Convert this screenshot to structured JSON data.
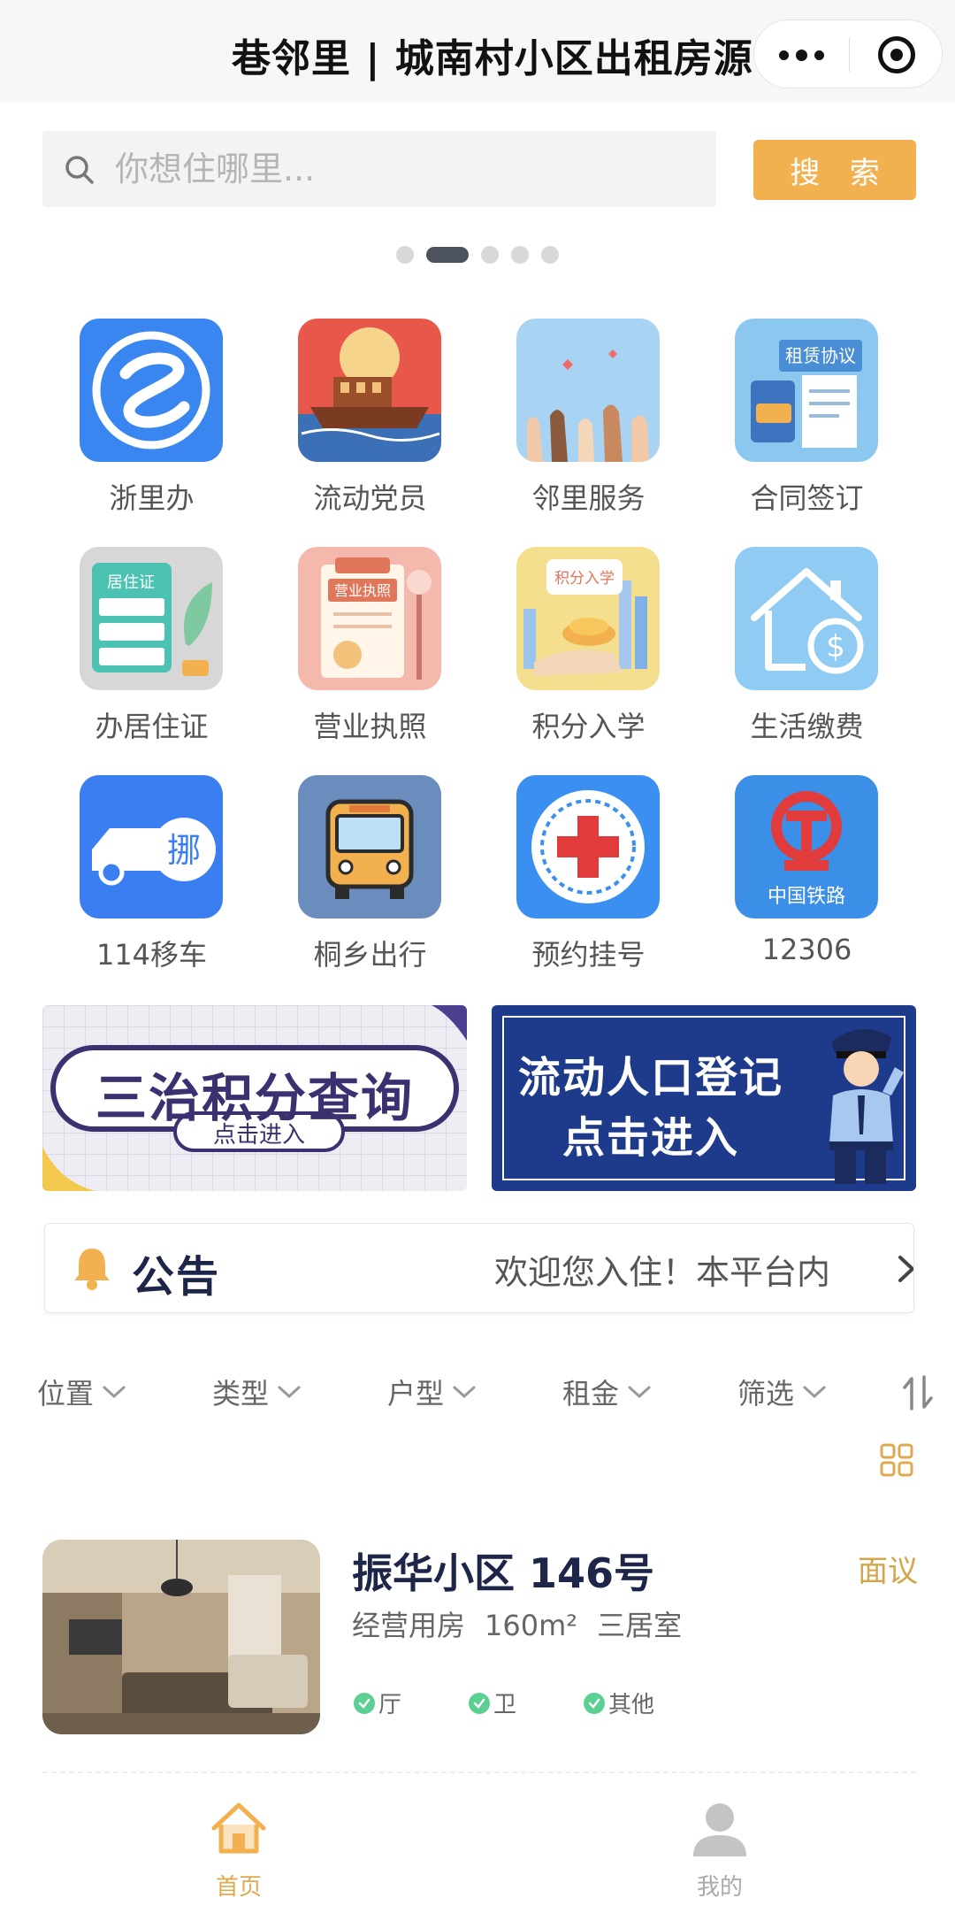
{
  "titlebar": {
    "title": "巷邻里 | 城南村小区出租房源"
  },
  "search": {
    "placeholder": "你想住哪里...",
    "button_label": "搜 索"
  },
  "carousel": {
    "dot_count": 5,
    "active_index": 1
  },
  "services": [
    {
      "label": "浙里办",
      "icon": "zheliban-icon"
    },
    {
      "label": "流动党员",
      "icon": "red-boat-icon"
    },
    {
      "label": "邻里服务",
      "icon": "raised-hands-icon"
    },
    {
      "label": "合同签订",
      "icon": "contract-icon",
      "icon_text": "租赁协议"
    },
    {
      "label": "办居住证",
      "icon": "residence-permit-icon",
      "icon_text": "居住证"
    },
    {
      "label": "营业执照",
      "icon": "business-license-icon",
      "icon_text": "营业执照"
    },
    {
      "label": "积分入学",
      "icon": "school-points-icon",
      "icon_text": "积分入学"
    },
    {
      "label": "生活缴费",
      "icon": "house-dollar-icon"
    },
    {
      "label": "114移车",
      "icon": "move-car-icon",
      "icon_text": "挪"
    },
    {
      "label": "桐乡出行",
      "icon": "bus-icon"
    },
    {
      "label": "预约挂号",
      "icon": "medical-cross-icon"
    },
    {
      "label": "12306",
      "icon": "china-railway-icon",
      "icon_text": "中国铁路"
    }
  ],
  "banners": {
    "left": {
      "title": "三治积分查询",
      "subtitle": "点击进入"
    },
    "right": {
      "line1": "流动人口登记",
      "line2": "点击进入"
    }
  },
  "notice": {
    "title": "公告",
    "text": "欢迎您入住！本平台内"
  },
  "filters": [
    "位置",
    "类型",
    "户型",
    "租金",
    "筛选"
  ],
  "listing": {
    "name": "振华小区 146号",
    "price": "面议",
    "type": "经营用房",
    "area": "160m²",
    "layout": "三居室",
    "tags": [
      "厅",
      "卫",
      "其他"
    ]
  },
  "tabbar": [
    {
      "label": "首页",
      "active": true
    },
    {
      "label": "我的",
      "active": false
    }
  ],
  "colors": {
    "accent": "#f3b04e",
    "price": "#d4a54a",
    "navy": "#1d2548",
    "check": "#5ccf92"
  }
}
